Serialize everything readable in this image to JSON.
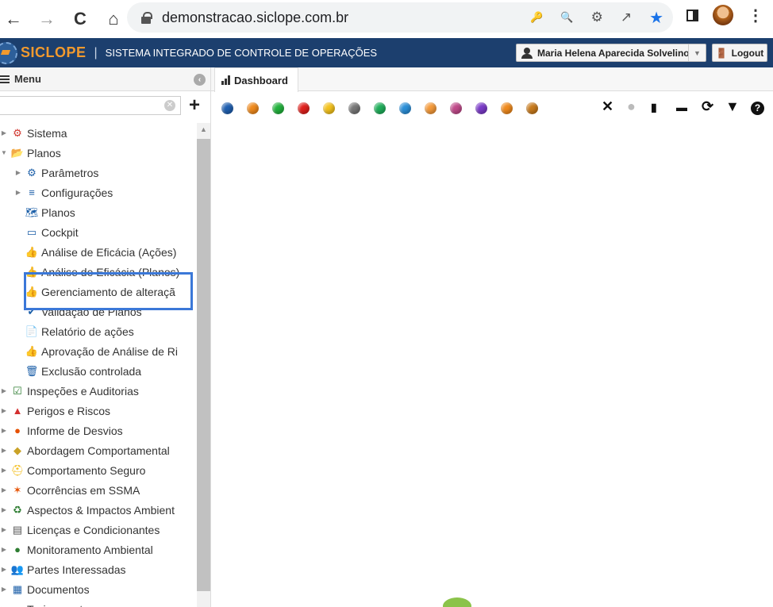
{
  "browser": {
    "url": "demonstracao.siclope.com.br",
    "nav_icons": [
      "←",
      "→",
      "C",
      "⌂"
    ],
    "omnibox_icons": [
      "🔑",
      "🔍",
      "⚙",
      "↗",
      "★"
    ]
  },
  "app": {
    "brand": "SICLOPE",
    "subtitle": "SISTEMA INTEGRADO DE CONTROLE DE OPERAÇÕES",
    "user_name": "Maria Helena Aparecida Solvelino",
    "logout_label": "Logout",
    "brand_color": "#f29a2e",
    "bar_color": "#1c3f6e"
  },
  "sidebar": {
    "menu_label": "Menu",
    "search_value": "",
    "items": [
      {
        "label": "Sistema",
        "level": 0,
        "arrow": "▶",
        "icon": "gear-icon",
        "glyph": "⚙",
        "color": "#d0342c"
      },
      {
        "label": "Planos",
        "level": 0,
        "arrow": "▼",
        "icon": "folder-open-icon",
        "glyph": "📂",
        "color": "#1c5fa8"
      },
      {
        "label": "Parâmetros",
        "level": 1,
        "arrow": "▶",
        "icon": "gear-icon",
        "glyph": "⚙",
        "color": "#1c5fa8"
      },
      {
        "label": "Configurações",
        "level": 1,
        "arrow": "▶",
        "icon": "sliders-icon",
        "glyph": "≡",
        "color": "#1c5fa8"
      },
      {
        "label": "Planos",
        "level": 2,
        "arrow": "",
        "icon": "map-icon",
        "glyph": "🗺",
        "color": "#1c5fa8"
      },
      {
        "label": "Cockpit",
        "level": 2,
        "arrow": "",
        "icon": "dashboard-icon",
        "glyph": "▭",
        "color": "#1c5fa8"
      },
      {
        "label": "Análise de Eficácia (Ações)",
        "level": 2,
        "arrow": "",
        "icon": "thumbs-up-icon",
        "glyph": "👍",
        "color": "#1c5fa8"
      },
      {
        "label": "Análise de Eficácia (Planos)",
        "level": 2,
        "arrow": "",
        "icon": "thumbs-up-icon",
        "glyph": "👍",
        "color": "#1c5fa8"
      },
      {
        "label": "Gerenciamento de alteraçã",
        "level": 2,
        "arrow": "",
        "icon": "thumbs-up-icon",
        "glyph": "👍",
        "color": "#1c5fa8"
      },
      {
        "label": "Validação de Planos",
        "level": 2,
        "arrow": "",
        "icon": "check-icon",
        "glyph": "✔",
        "color": "#1c5fa8"
      },
      {
        "label": "Relatório de ações",
        "level": 2,
        "arrow": "",
        "icon": "pdf-icon",
        "glyph": "📄",
        "color": "#1c5fa8"
      },
      {
        "label": "Aprovação de Análise de Ri",
        "level": 2,
        "arrow": "",
        "icon": "thumbs-up-filled-icon",
        "glyph": "👍",
        "color": "#1c5fa8"
      },
      {
        "label": "Exclusão controlada",
        "level": 2,
        "arrow": "",
        "icon": "trash-icon",
        "glyph": "🗑",
        "color": "#1c5fa8"
      },
      {
        "label": "Inspeções e Auditorias",
        "level": 0,
        "arrow": "▶",
        "icon": "clipboard-check-icon",
        "glyph": "☑",
        "color": "#2e7d32"
      },
      {
        "label": "Perigos e Riscos",
        "level": 0,
        "arrow": "▶",
        "icon": "warning-icon",
        "glyph": "▲",
        "color": "#d32f2f"
      },
      {
        "label": "Informe de Desvios",
        "level": 0,
        "arrow": "▶",
        "icon": "chat-icon",
        "glyph": "●",
        "color": "#e65100"
      },
      {
        "label": "Abordagem Comportamental",
        "level": 0,
        "arrow": "▶",
        "icon": "diamond-icon",
        "glyph": "◆",
        "color": "#c9a227"
      },
      {
        "label": "Comportamento Seguro",
        "level": 0,
        "arrow": "▶",
        "icon": "hardhat-icon",
        "glyph": "⛑",
        "color": "#f2b705"
      },
      {
        "label": "Ocorrências em SSMA",
        "level": 0,
        "arrow": "▶",
        "icon": "fall-icon",
        "glyph": "✶",
        "color": "#e65100"
      },
      {
        "label": "Aspectos & Impactos Ambient",
        "level": 0,
        "arrow": "▶",
        "icon": "recycle-icon",
        "glyph": "♻",
        "color": "#2e7d32"
      },
      {
        "label": "Licenças e Condicionantes",
        "level": 0,
        "arrow": "▶",
        "icon": "license-icon",
        "glyph": "▤",
        "color": "#555555"
      },
      {
        "label": "Monitoramento Ambiental",
        "level": 0,
        "arrow": "▶",
        "icon": "tree-icon",
        "glyph": "●",
        "color": "#2e7d32"
      },
      {
        "label": "Partes Interessadas",
        "level": 0,
        "arrow": "▶",
        "icon": "people-icon",
        "glyph": "👥",
        "color": "#f29a2e"
      },
      {
        "label": "Documentos",
        "level": 0,
        "arrow": "▶",
        "icon": "document-icon",
        "glyph": "▦",
        "color": "#1c5fa8"
      },
      {
        "label": "Treinamentos",
        "level": 0,
        "arrow": "▶",
        "icon": "training-icon",
        "glyph": "●",
        "color": "#c2185b"
      }
    ]
  },
  "tab": {
    "label": "Dashboard"
  },
  "toolbar": {
    "dot_colors": [
      "#1f5fb0",
      "#f08a1c",
      "#22b23c",
      "#e0201c",
      "#f4c21c",
      "#777777",
      "#1fae5a",
      "#2b8fd8",
      "#f59a3a",
      "#c04a8a",
      "#7a3ac8",
      "#f08a1c",
      "#c87a1c"
    ],
    "right_icons": [
      {
        "name": "close-icon",
        "glyph": "✕"
      },
      {
        "name": "gray-dot-icon",
        "glyph": "●"
      },
      {
        "name": "bar-chart-icon",
        "glyph": "▮"
      },
      {
        "name": "pulse-icon",
        "glyph": "▬"
      },
      {
        "name": "refresh-icon",
        "glyph": "⟳"
      },
      {
        "name": "filter-icon",
        "glyph": "▼"
      },
      {
        "name": "help-icon",
        "glyph": "?"
      }
    ]
  }
}
